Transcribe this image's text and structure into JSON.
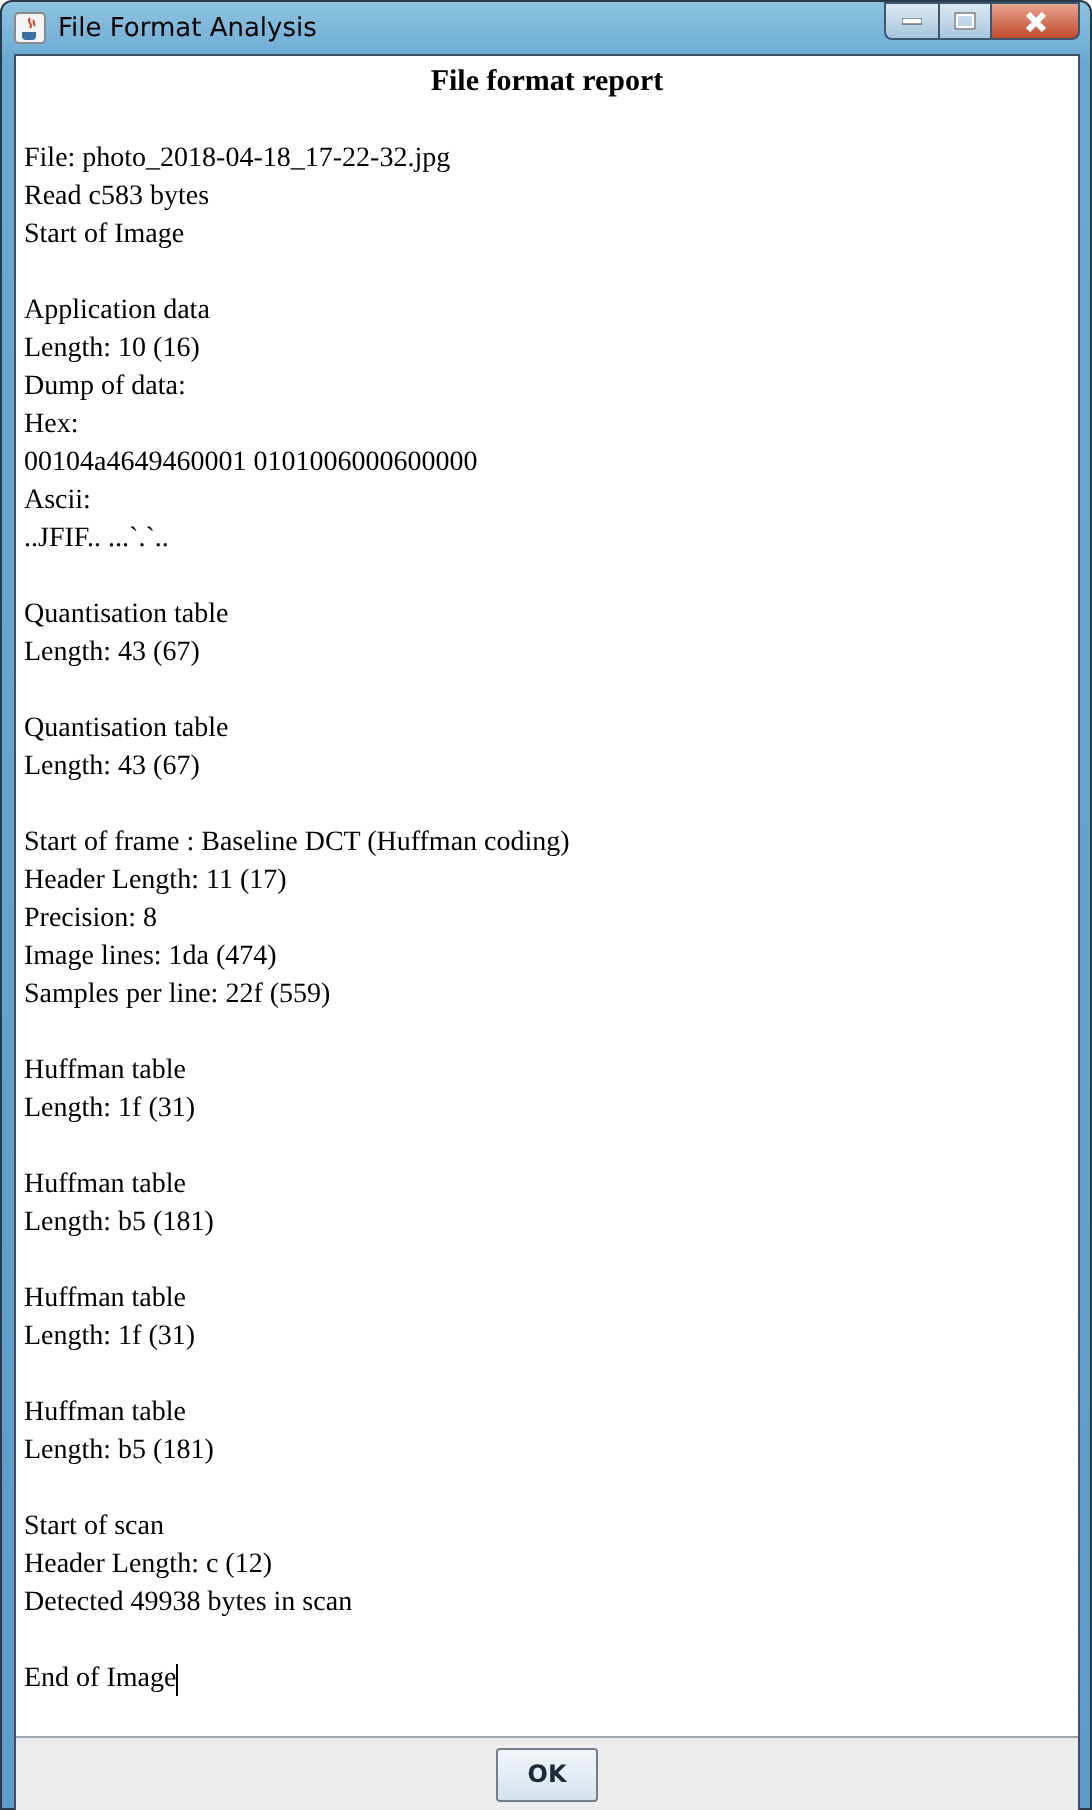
{
  "window": {
    "title": "File Format Analysis"
  },
  "report": {
    "title": "File format report",
    "sections": [
      [
        "File: photo_2018-04-18_17-22-32.jpg",
        "Read c583 bytes",
        "Start of Image"
      ],
      [
        "Application data",
        "Length: 10 (16)",
        "Dump of data:",
        "Hex:",
        "00104a4649460001 0101006000600000",
        "Ascii:",
        "..JFIF.. ...`.`.."
      ],
      [
        "Quantisation table",
        "Length: 43 (67)"
      ],
      [
        "Quantisation table",
        "Length: 43 (67)"
      ],
      [
        "Start of frame : Baseline DCT (Huffman coding)",
        "Header Length: 11 (17)",
        "Precision: 8",
        "Image lines: 1da (474)",
        "Samples per line: 22f (559)"
      ],
      [
        "Huffman table",
        "Length: 1f (31)"
      ],
      [
        "Huffman table",
        "Length: b5 (181)"
      ],
      [
        "Huffman table",
        "Length: 1f (31)"
      ],
      [
        "Huffman table",
        "Length: b5 (181)"
      ],
      [
        "Start of scan",
        "Header Length: c (12)",
        "Detected 49938 bytes in scan"
      ],
      [
        "End of Image"
      ]
    ]
  },
  "buttons": [
    "OK"
  ]
}
